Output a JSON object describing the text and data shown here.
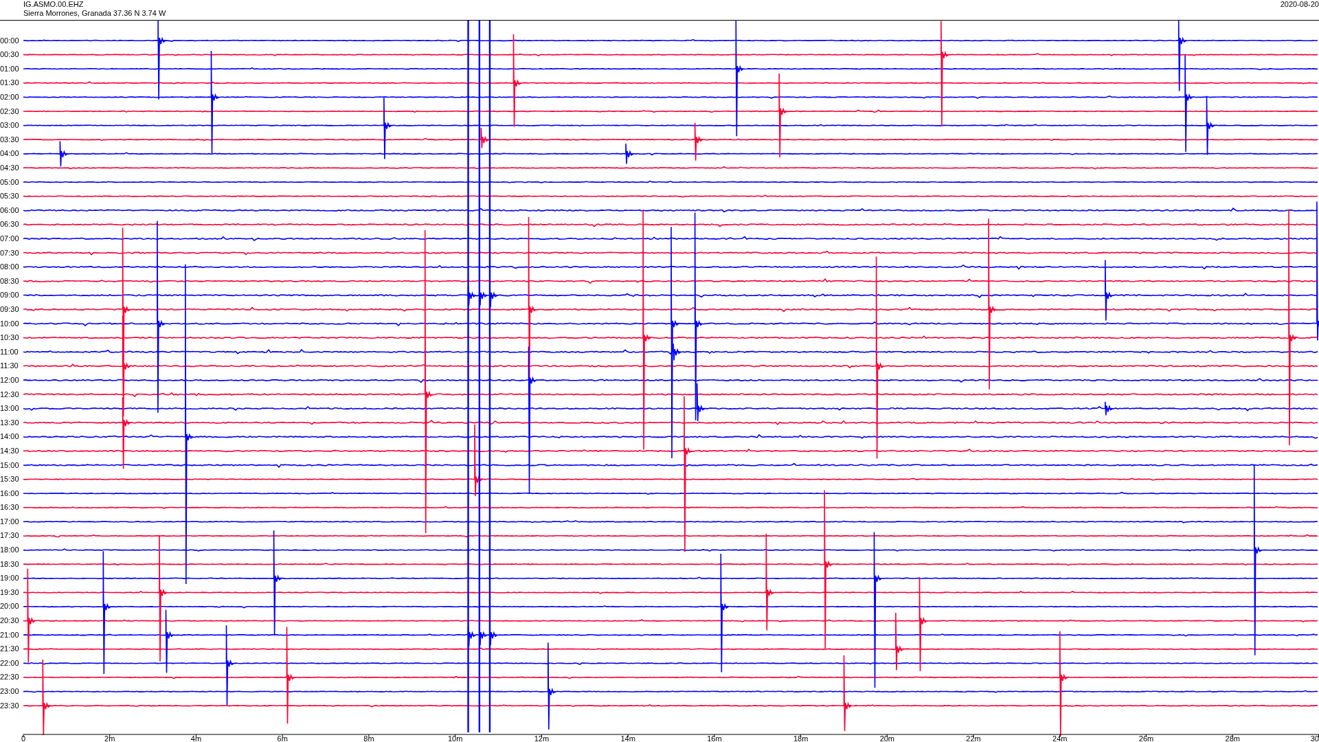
{
  "header": {
    "station": "IG.ASMO.00.EHZ",
    "location": "Sierra Morrones, Granada  37.36 N 3.74 W",
    "date": "2020-08-20"
  },
  "rows": [
    {
      "label": "00:00",
      "color": "#0000ff"
    },
    {
      "label": "00:30",
      "color": "#ff0033"
    },
    {
      "label": "01:00",
      "color": "#0000ff"
    },
    {
      "label": "01:30",
      "color": "#ff0033"
    },
    {
      "label": "02:00",
      "color": "#0000ff"
    },
    {
      "label": "02:30",
      "color": "#ff0033"
    },
    {
      "label": "03:00",
      "color": "#0000ff"
    },
    {
      "label": "03:30",
      "color": "#ff0033"
    },
    {
      "label": "04:00",
      "color": "#0000ff"
    },
    {
      "label": "04:30",
      "color": "#ff0033"
    },
    {
      "label": "05:00",
      "color": "#0000ff"
    },
    {
      "label": "05:30",
      "color": "#ff0033"
    },
    {
      "label": "06:00",
      "color": "#0000ff"
    },
    {
      "label": "06:30",
      "color": "#ff0033"
    },
    {
      "label": "07:00",
      "color": "#0000ff"
    },
    {
      "label": "07:30",
      "color": "#ff0033"
    },
    {
      "label": "08:00",
      "color": "#0000ff"
    },
    {
      "label": "08:30",
      "color": "#ff0033"
    },
    {
      "label": "09:00",
      "color": "#0000ff"
    },
    {
      "label": "09:30",
      "color": "#ff0033"
    },
    {
      "label": "10:00",
      "color": "#0000ff"
    },
    {
      "label": "10:30",
      "color": "#ff0033"
    },
    {
      "label": "11:00",
      "color": "#0000ff"
    },
    {
      "label": "11:30",
      "color": "#ff0033"
    },
    {
      "label": "12:00",
      "color": "#0000ff"
    },
    {
      "label": "12:30",
      "color": "#ff0033"
    },
    {
      "label": "13:00",
      "color": "#0000ff"
    },
    {
      "label": "13:30",
      "color": "#ff0033"
    },
    {
      "label": "14:00",
      "color": "#0000ff"
    },
    {
      "label": "14:30",
      "color": "#ff0033"
    },
    {
      "label": "15:00",
      "color": "#0000ff"
    },
    {
      "label": "15:30",
      "color": "#ff0033"
    },
    {
      "label": "16:00",
      "color": "#0000ff"
    },
    {
      "label": "16:30",
      "color": "#ff0033"
    },
    {
      "label": "17:00",
      "color": "#0000ff"
    },
    {
      "label": "17:30",
      "color": "#ff0033"
    },
    {
      "label": "18:00",
      "color": "#0000ff"
    },
    {
      "label": "18:30",
      "color": "#ff0033"
    },
    {
      "label": "19:00",
      "color": "#0000ff"
    },
    {
      "label": "19:30",
      "color": "#ff0033"
    },
    {
      "label": "20:00",
      "color": "#0000ff"
    },
    {
      "label": "20:30",
      "color": "#ff0033"
    },
    {
      "label": "21:00",
      "color": "#0000ff"
    },
    {
      "label": "21:30",
      "color": "#ff0033"
    },
    {
      "label": "22:00",
      "color": "#0000ff"
    },
    {
      "label": "22:30",
      "color": "#ff0033"
    },
    {
      "label": "23:00",
      "color": "#0000ff"
    },
    {
      "label": "23:30",
      "color": "#ff0033"
    }
  ],
  "x_axis": {
    "ticks": [
      "0",
      "2m",
      "4m",
      "6m",
      "8m",
      "10m",
      "12m",
      "14m",
      "16m",
      "18m",
      "20m",
      "22m",
      "24m",
      "26m",
      "28m",
      "30"
    ]
  }
}
